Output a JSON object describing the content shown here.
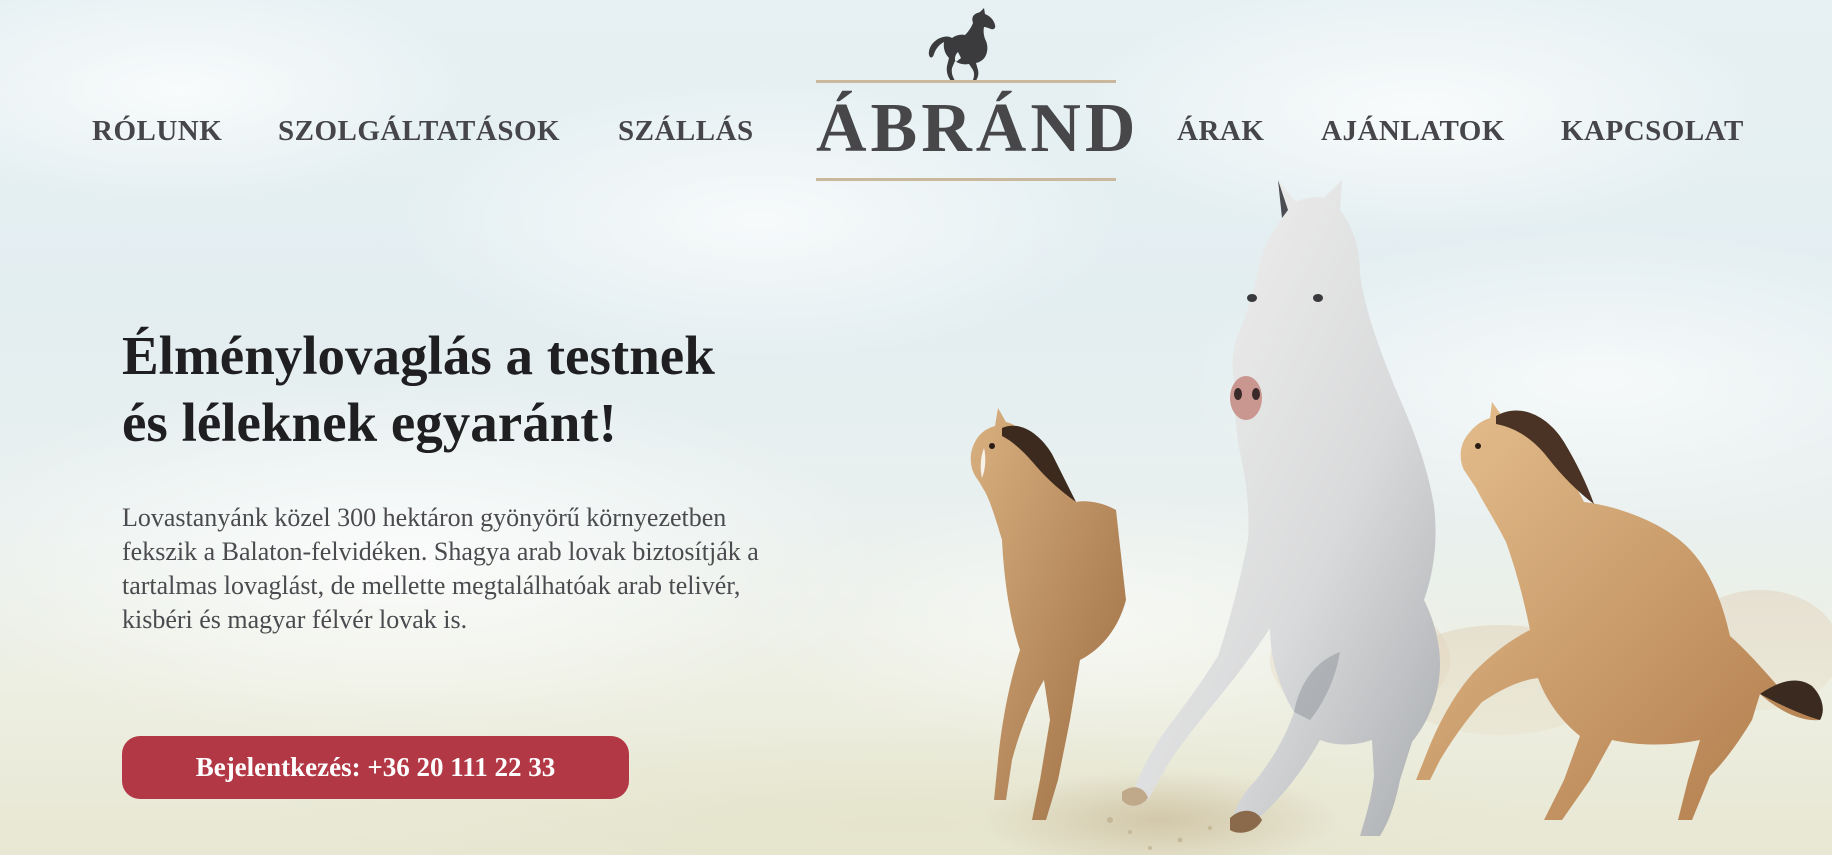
{
  "brand": {
    "logo_text": "ÁBRÁND"
  },
  "nav": {
    "left": [
      "RÓLUNK",
      "SZOLGÁLTATÁSOK",
      "SZÁLLÁS"
    ],
    "right": [
      "ÁRAK",
      "AJÁNLATOK",
      "KAPCSOLAT"
    ]
  },
  "hero": {
    "title_lines": [
      "Élménylovaglás a testnek",
      "és léleknek egyaránt!"
    ],
    "description_lines": [
      "Lovastanyánk közel 300 hektáron gyönyörű környezetben",
      "fekszik a Balaton-felvidéken. Shagya arab lovak biztosítják a",
      "tartalmas lovaglást, de mellette megtalálhatóak arab telivér,",
      "kisbéri és magyar félvér lovak is."
    ],
    "cta_label": "Bejelentkezés: +36 20 111 22 33"
  },
  "colors": {
    "nav_text": "#46464a",
    "logo_line": "#c9b89c",
    "cta_background": "#b23845",
    "title_text": "#1f1f21"
  },
  "icons": {
    "logo_mark": "rearing-horse-icon"
  }
}
